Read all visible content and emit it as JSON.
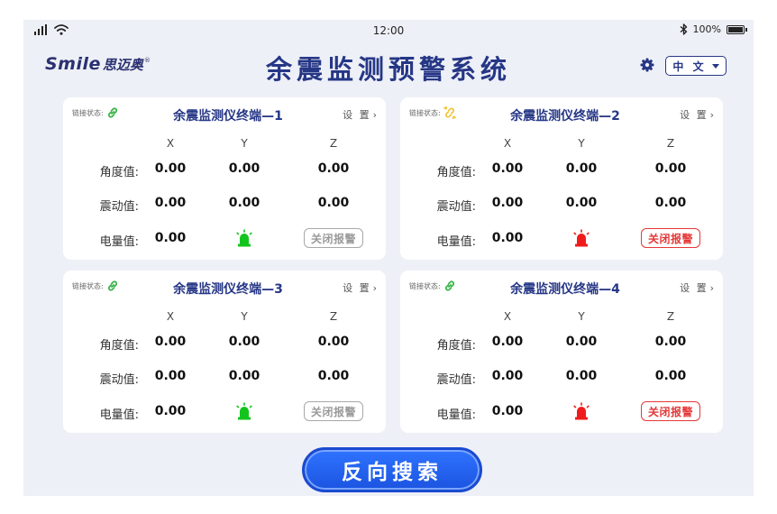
{
  "status_bar": {
    "time": "12:00",
    "battery_percent": "100%"
  },
  "header": {
    "logo_en": "Smile",
    "logo_cn": "思迈奥",
    "logo_reg": "®",
    "title": "余震监测预警系统",
    "language": "中 文"
  },
  "labels": {
    "link_status": "链接状态:",
    "settings": "设 置",
    "col_x": "X",
    "col_y": "Y",
    "col_z": "Z",
    "angle": "角度值:",
    "vibration": "震动值:",
    "battery": "电量值:"
  },
  "colors": {
    "title_blue": "#263786",
    "link_ok": "#3bb54a",
    "link_searching": "#f2c12e",
    "lamp_green": "#14c41e",
    "lamp_red": "#f01c1c",
    "alarm_active": "#e43838",
    "alarm_inactive": "#a8a8a8"
  },
  "terminals": [
    {
      "title": "余震监测仪终端—1",
      "link_icon": "link-connected-icon",
      "angle": {
        "x": "0.00",
        "y": "0.00",
        "z": "0.00"
      },
      "vibration": {
        "x": "0.00",
        "y": "0.00",
        "z": "0.00"
      },
      "battery": "0.00",
      "lamp": "green-alarm-lamp-icon",
      "alarm_button": "关闭报警",
      "alarm_active": false
    },
    {
      "title": "余震监测仪终端—2",
      "link_icon": "link-searching-icon",
      "angle": {
        "x": "0.00",
        "y": "0.00",
        "z": "0.00"
      },
      "vibration": {
        "x": "0.00",
        "y": "0.00",
        "z": "0.00"
      },
      "battery": "0.00",
      "lamp": "red-alarm-lamp-icon",
      "alarm_button": "关闭报警",
      "alarm_active": true
    },
    {
      "title": "余震监测仪终端—3",
      "link_icon": "link-connected-icon",
      "angle": {
        "x": "0.00",
        "y": "0.00",
        "z": "0.00"
      },
      "vibration": {
        "x": "0.00",
        "y": "0.00",
        "z": "0.00"
      },
      "battery": "0.00",
      "lamp": "green-alarm-lamp-icon",
      "alarm_button": "关闭报警",
      "alarm_active": false
    },
    {
      "title": "余震监测仪终端—4",
      "link_icon": "link-connected-icon",
      "angle": {
        "x": "0.00",
        "y": "0.00",
        "z": "0.00"
      },
      "vibration": {
        "x": "0.00",
        "y": "0.00",
        "z": "0.00"
      },
      "battery": "0.00",
      "lamp": "red-alarm-lamp-icon",
      "alarm_button": "关闭报警",
      "alarm_active": true
    }
  ],
  "search_button": "反向搜索"
}
